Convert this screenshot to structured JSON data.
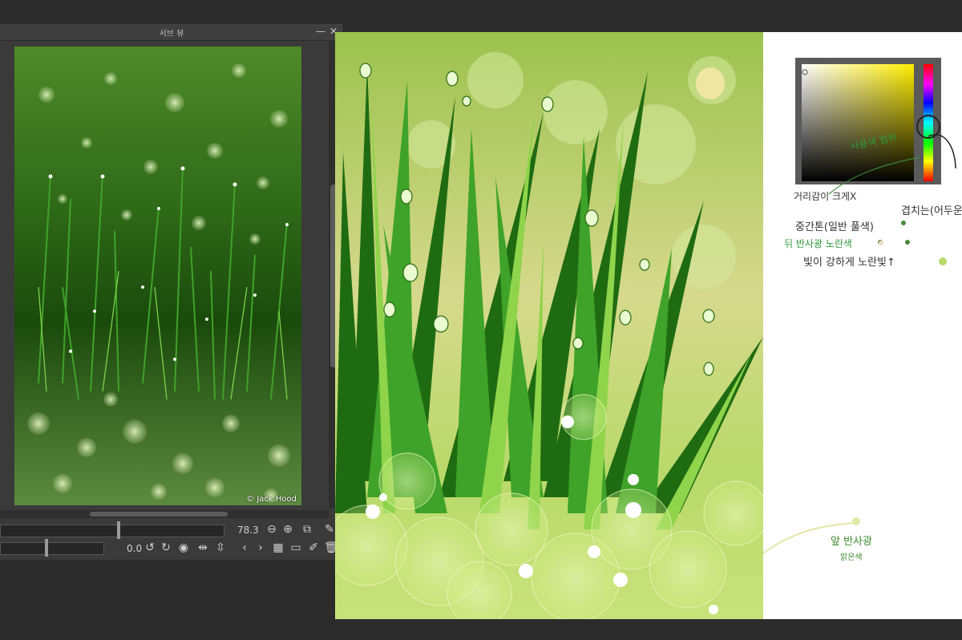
{
  "sub_view": {
    "title": "서브 뷰",
    "minimize_label": "—",
    "close_label": "✕",
    "photo_credit": "© Jack Hood",
    "zoom_value": "78.3",
    "rotation_value": "0.0"
  },
  "notes": {
    "range_label": "사용색 범위",
    "distance_label": "거리감이 크게X",
    "middle_label": "중간톤(일반 풀색)",
    "overlap_label": "겹치는(어두운",
    "back_label": "뒤 반사광 노란색",
    "light_label": "빛이 강하게 노란빛↑",
    "front_label": "앞 반사광",
    "front_sub_label": "맑은색"
  },
  "colors": {
    "panel_bg": "#3a3a3a",
    "app_bg": "#2b2b2b",
    "grass_dark": "#1f6b12",
    "grass_light": "#7ec93a",
    "bg_yellow": "#d8dc8a",
    "note_green": "#3a9a3a"
  }
}
